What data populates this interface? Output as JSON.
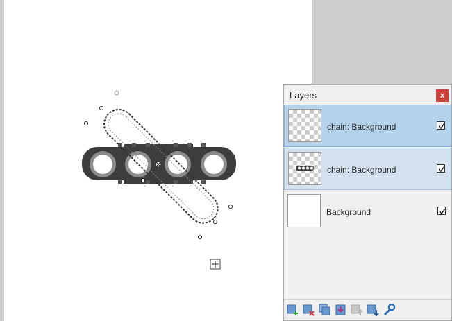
{
  "layers_panel": {
    "title": "Layers",
    "close_label": "x",
    "layers": [
      {
        "name": "chain: Background",
        "visible": true,
        "selected": true
      },
      {
        "name": "chain: Background",
        "visible": true,
        "selected": true
      },
      {
        "name": "Background",
        "visible": true,
        "selected": false
      }
    ],
    "toolbar": [
      "add-layer-icon",
      "delete-layer-icon",
      "duplicate-layer-icon",
      "merge-down-icon",
      "move-up-icon",
      "move-down-icon",
      "properties-icon"
    ]
  },
  "colors": {
    "selection_primary": "#b6d3ec",
    "selection_secondary": "#d4e2f0",
    "close_button": "#c9413b",
    "chain_dark": "#3d3d3d"
  }
}
